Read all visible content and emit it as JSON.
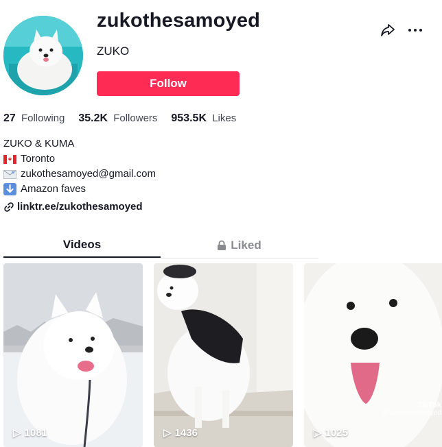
{
  "profile": {
    "username": "zukothesamoyed",
    "nickname": "ZUKO",
    "follow_label": "Follow"
  },
  "stats": {
    "following_count": "27",
    "following_label": "Following",
    "followers_count": "35.2K",
    "followers_label": "Followers",
    "likes_count": "953.5K",
    "likes_label": "Likes"
  },
  "bio": {
    "line1": "ZUKO & KUMA",
    "line2": "Toronto",
    "line3": "zukothesamoyed@gmail.com",
    "line4": "Amazon faves",
    "link": "linktr.ee/zukothesamoyed"
  },
  "tabs": {
    "videos": "Videos",
    "liked": "Liked"
  },
  "videos": [
    {
      "views": "1081"
    },
    {
      "views": "1436"
    },
    {
      "views": "1025",
      "watermark_brand": "TikTok",
      "watermark_handle": "@zukothesamoyed"
    }
  ],
  "colors": {
    "accent": "#fe2c55",
    "text": "#161823",
    "muted": "#8a8b91"
  }
}
